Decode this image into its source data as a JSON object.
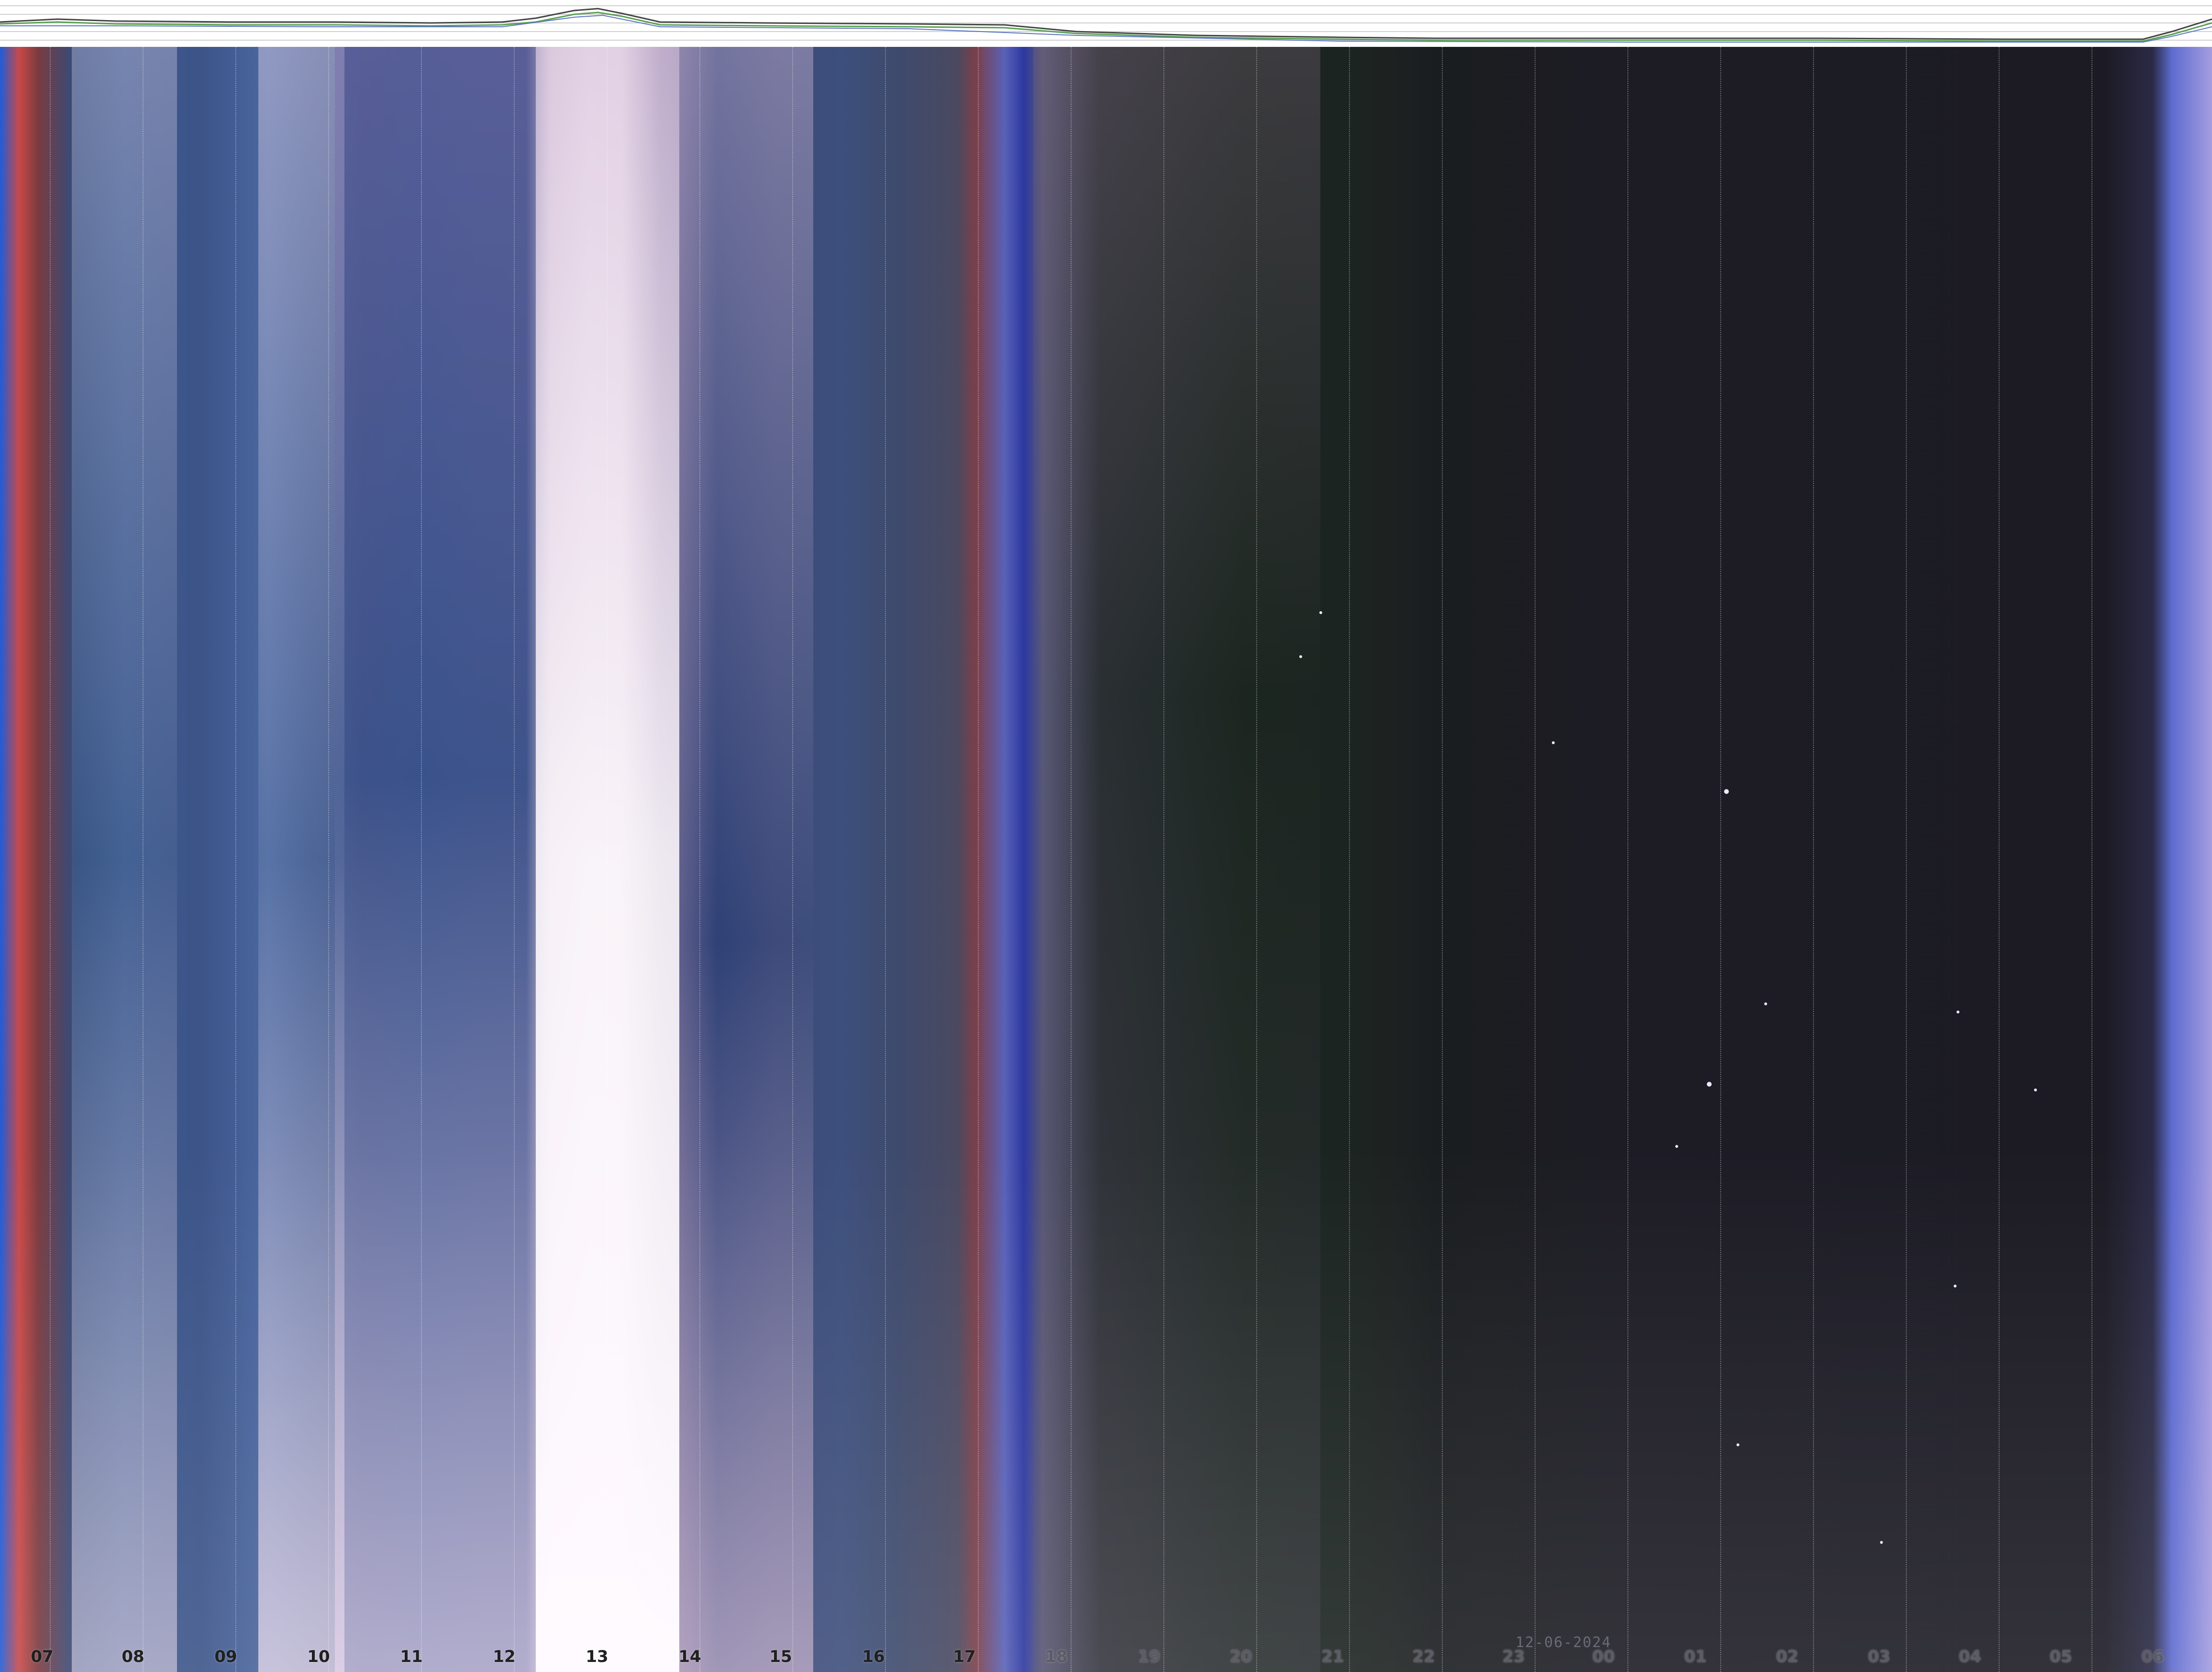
{
  "hour_labels": [
    "07",
    "08",
    "09",
    "10",
    "11",
    "12",
    "13",
    "14",
    "15",
    "16",
    "17",
    "18",
    "19",
    "20",
    "21",
    "22",
    "23",
    "00",
    "01",
    "02",
    "03",
    "04",
    "05",
    "06"
  ],
  "date": "12-06-2024"
}
